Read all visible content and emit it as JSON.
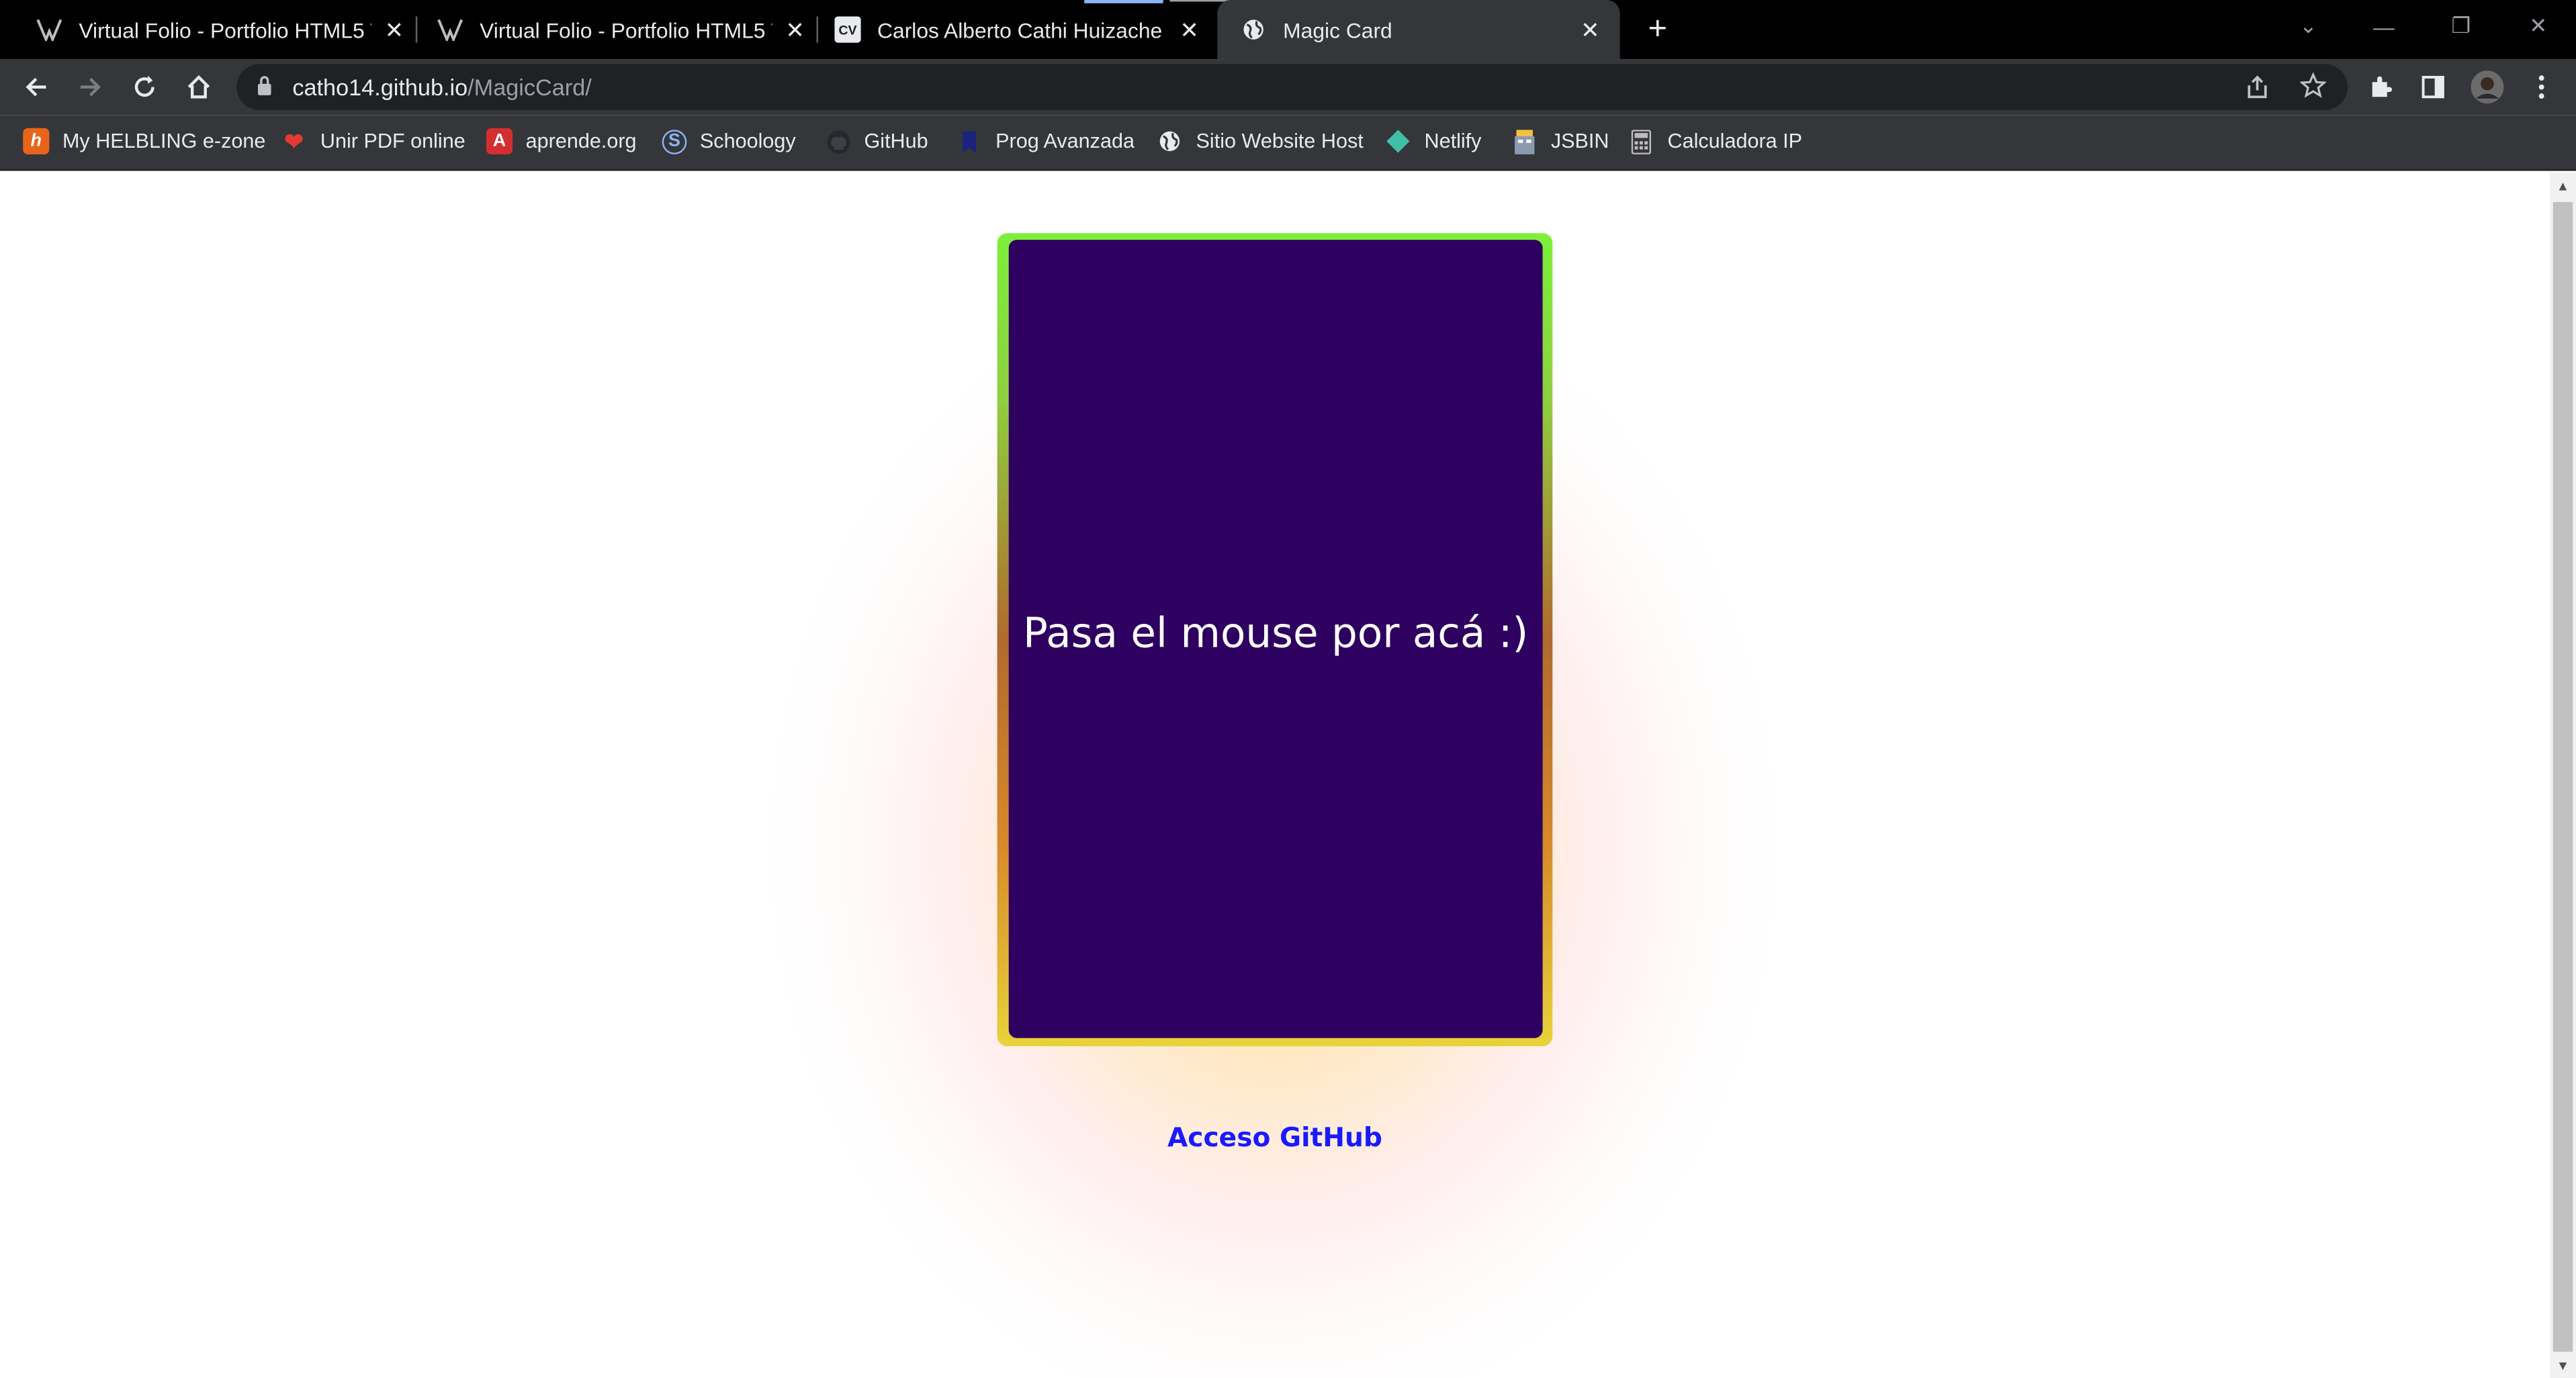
{
  "browser": {
    "tabs": [
      {
        "title": "Virtual Folio - Portfolio HTML5 Te",
        "favicon": "v-logo-icon",
        "active": false
      },
      {
        "title": "Virtual Folio - Portfolio HTML5 Te",
        "favicon": "v-logo-icon",
        "active": false
      },
      {
        "title": "Carlos Alberto Cathi Huizache",
        "favicon": "cv-icon",
        "favicon_text": "CV",
        "active": false
      },
      {
        "title": "Magic Card",
        "favicon": "globe-icon",
        "active": true
      }
    ],
    "new_tab_label": "+",
    "address": {
      "host": "catho14.github.io",
      "path": "/MagicCard/"
    },
    "bookmarks": [
      {
        "label": "My HELBLING e-zone",
        "icon": "helbling-icon",
        "color": "#e8641b",
        "glyph": "h"
      },
      {
        "label": "Unir PDF online",
        "icon": "heart-icon",
        "color": "#e53935",
        "glyph": "❤"
      },
      {
        "label": "aprende.org",
        "icon": "aprende-icon",
        "color": "#d32f2f",
        "glyph": "A"
      },
      {
        "label": "Schoology",
        "icon": "schoology-icon",
        "color": "#1e88e5",
        "glyph": "S"
      },
      {
        "label": "GitHub",
        "icon": "github-icon",
        "color": "#333333",
        "glyph": "●"
      },
      {
        "label": "Prog Avanzada",
        "icon": "prog-icon",
        "color": "#1a237e",
        "glyph": "●"
      },
      {
        "label": "Sitio Website Host",
        "icon": "globe-icon",
        "color": "#e8eaed",
        "glyph": "🌐"
      },
      {
        "label": "Netlify",
        "icon": "netlify-icon",
        "color": "#3fbfa8",
        "glyph": "◆"
      },
      {
        "label": "JSBIN",
        "icon": "jsbin-icon",
        "color": "#f0c040",
        "glyph": "▦"
      },
      {
        "label": "Calculadora IP",
        "icon": "calculator-icon",
        "color": "#bdbdbd",
        "glyph": "▤"
      }
    ]
  },
  "page": {
    "card_text": "Pasa el mouse por acá :)",
    "link_text": "Acceso GitHub",
    "colors": {
      "card_bg": "#2e005f",
      "link": "#1a1aff",
      "border_top": "#7cf03a",
      "border_bottom": "#e8d33a"
    }
  }
}
